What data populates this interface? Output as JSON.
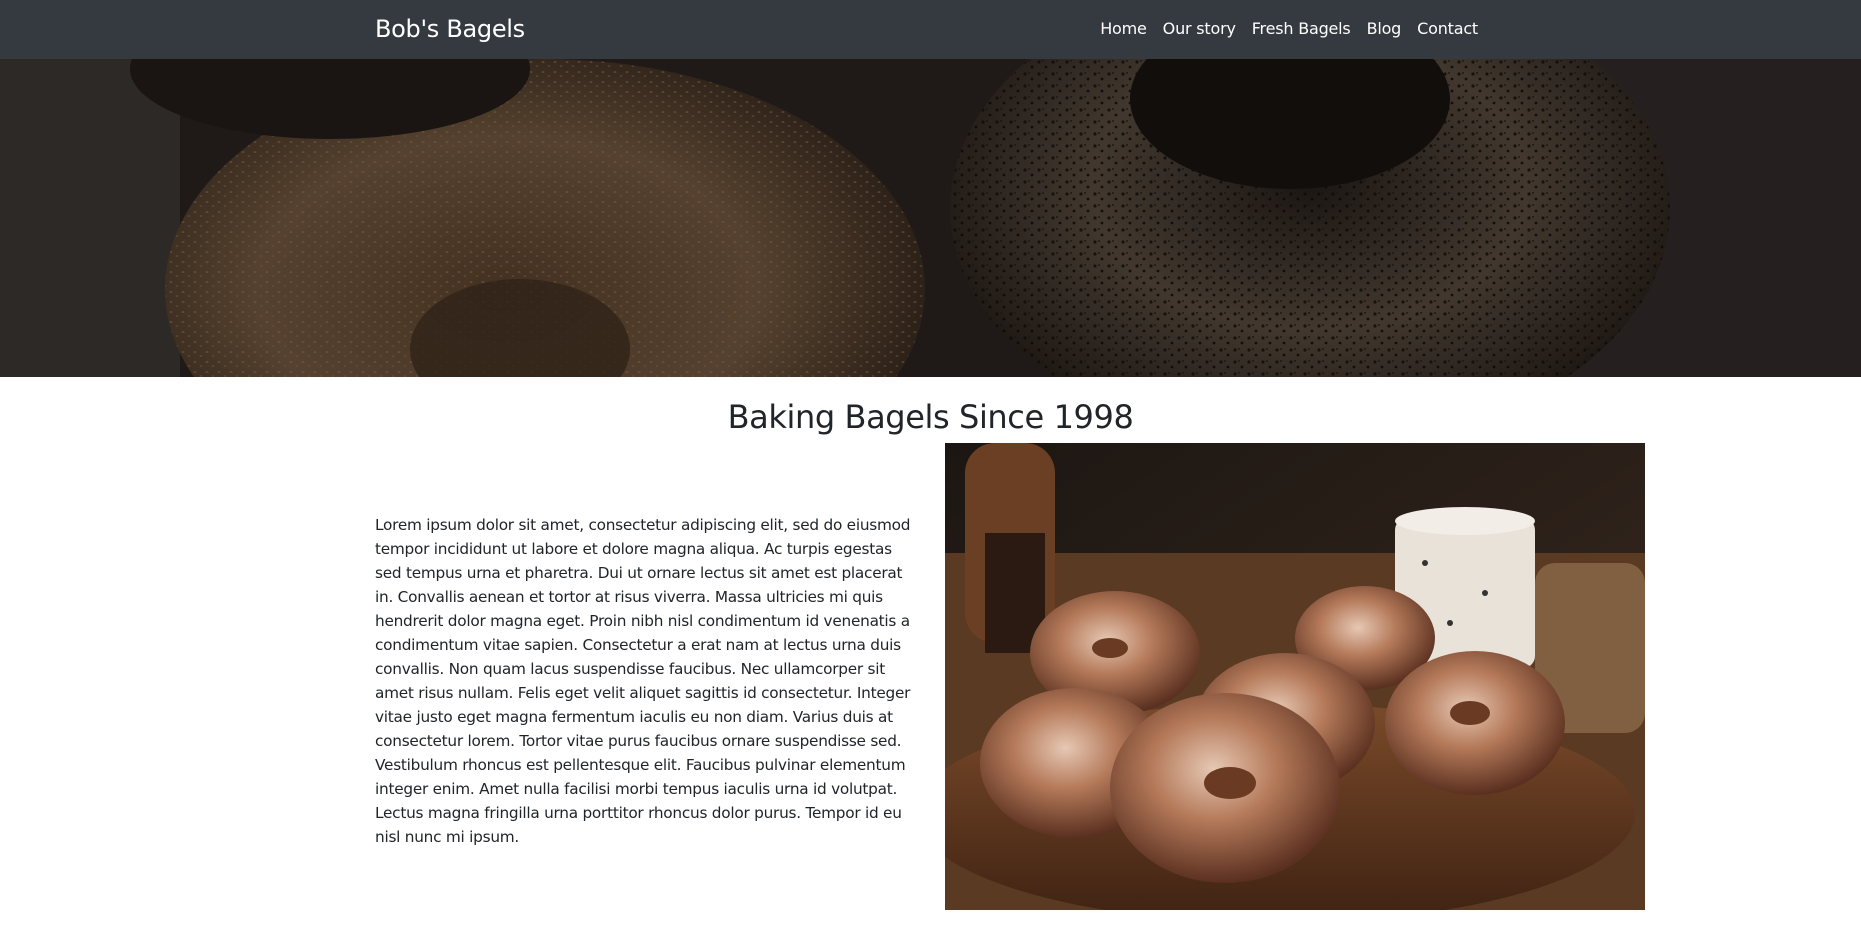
{
  "navbar": {
    "brand": "Bob's Bagels",
    "links": [
      "Home",
      "Our story",
      "Fresh Bagels",
      "Blog",
      "Contact"
    ]
  },
  "hero": {
    "image": "hero-bagels-image"
  },
  "main": {
    "headline": "Baking Bagels Since 1998",
    "story_text": "Lorem ipsum dolor sit amet, consectetur adipiscing elit, sed do eiusmod tempor incididunt ut labore et dolore magna aliqua. Ac turpis egestas sed tempus urna et pharetra. Dui ut ornare lectus sit amet est placerat in. Convallis aenean et tortor at risus viverra. Massa ultricies mi quis hendrerit dolor magna eget. Proin nibh nisl condimentum id venenatis a condimentum vitae sapien. Consectetur a erat nam at lectus urna duis convallis. Non quam lacus suspendisse faucibus. Nec ullamcorper sit amet risus nullam. Felis eget velit aliquet sagittis id consectetur. Integer vitae justo eget magna fermentum iaculis eu non diam. Varius duis at consectetur lorem. Tortor vitae purus faucibus ornare suspendisse sed. Vestibulum rhoncus est pellentesque elit. Faucibus pulvinar elementum integer enim. Amet nulla facilisi morbi tempus iaculis urna id volutpat. Lectus magna fringilla urna porttitor rhoncus dolor purus. Tempor id eu nisl nunc mi ipsum.",
    "photo": "donuts-photo"
  },
  "colors": {
    "navbar_bg": "#343a40",
    "nav_text": "#ffffff",
    "body_text": "#212529",
    "page_bg": "#ffffff"
  }
}
